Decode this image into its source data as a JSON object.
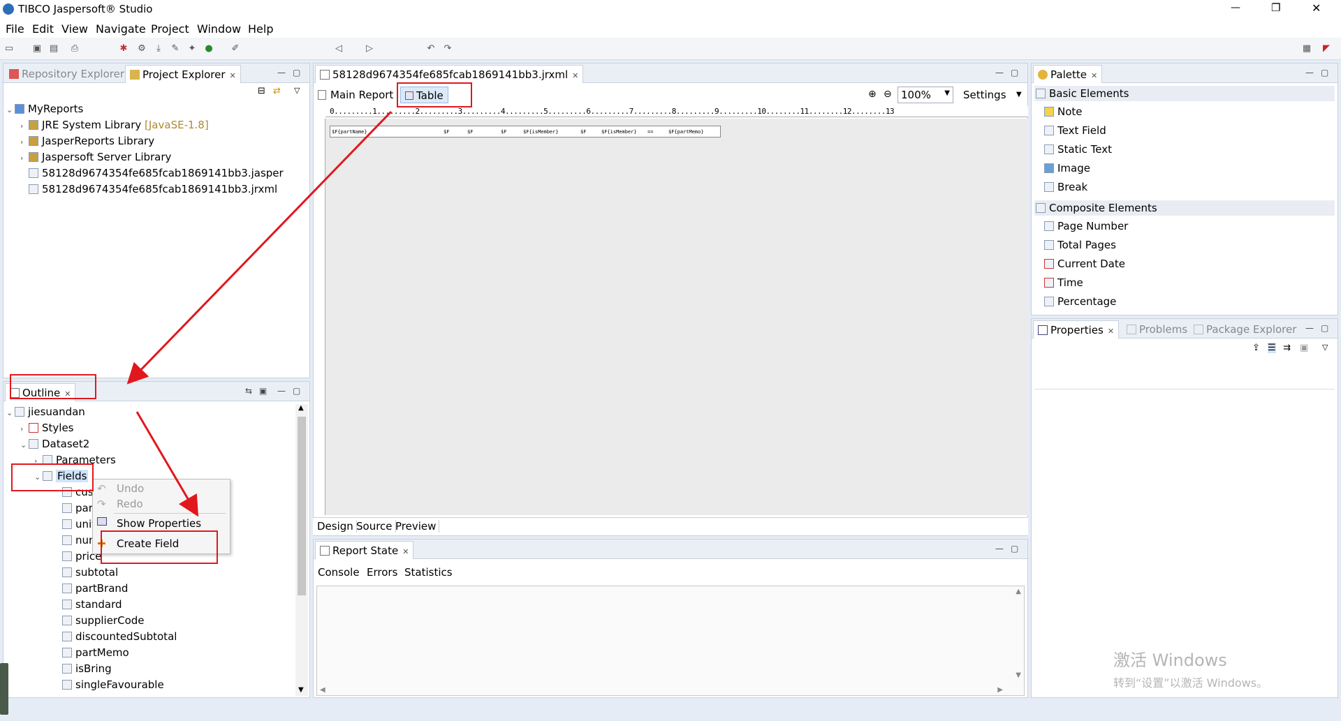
{
  "app": {
    "title": "TIBCO Jaspersoft® Studio",
    "window_controls": {
      "minimize": "—",
      "restore": "❐",
      "close": "✕"
    }
  },
  "menu": [
    "File",
    "Edit",
    "View",
    "Navigate",
    "Project",
    "Window",
    "Help"
  ],
  "left_top": {
    "tabs": [
      "Repository Explorer",
      "Project Explorer"
    ],
    "tree": [
      {
        "label": "MyReports",
        "level": 0,
        "exp": "⌄"
      },
      {
        "label": "JRE System Library",
        "suffix": "[JavaSE-1.8]",
        "level": 1,
        "exp": "›"
      },
      {
        "label": "JasperReports Library",
        "level": 1,
        "exp": "›"
      },
      {
        "label": "Jaspersoft Server Library",
        "level": 1,
        "exp": "›"
      },
      {
        "label": "58128d9674354fe685fcab1869141bb3.jasper",
        "level": 1,
        "exp": ""
      },
      {
        "label": "58128d9674354fe685fcab1869141bb3.jrxml",
        "level": 1,
        "exp": ""
      }
    ]
  },
  "outline": {
    "tab": "Outline",
    "tree": [
      {
        "label": "jiesuandan",
        "level": 0,
        "exp": "⌄"
      },
      {
        "label": "Styles",
        "level": 1,
        "exp": "›"
      },
      {
        "label": "Dataset2",
        "level": 1,
        "exp": "⌄"
      },
      {
        "label": "Parameters",
        "level": 2,
        "exp": "›"
      },
      {
        "label": "Fields",
        "level": 2,
        "exp": "⌄"
      },
      {
        "label": "cus",
        "level": 3,
        "exp": ""
      },
      {
        "label": "par",
        "level": 3,
        "exp": ""
      },
      {
        "label": "unit",
        "level": 3,
        "exp": ""
      },
      {
        "label": "nun",
        "level": 3,
        "exp": ""
      },
      {
        "label": "price",
        "level": 3,
        "exp": ""
      },
      {
        "label": "subtotal",
        "level": 3,
        "exp": ""
      },
      {
        "label": "partBrand",
        "level": 3,
        "exp": ""
      },
      {
        "label": "standard",
        "level": 3,
        "exp": ""
      },
      {
        "label": "supplierCode",
        "level": 3,
        "exp": ""
      },
      {
        "label": "discountedSubtotal",
        "level": 3,
        "exp": ""
      },
      {
        "label": "partMemo",
        "level": 3,
        "exp": ""
      },
      {
        "label": "isBring",
        "level": 3,
        "exp": ""
      },
      {
        "label": "singleFavourable",
        "level": 3,
        "exp": ""
      }
    ]
  },
  "context_menu": {
    "undo": "Undo",
    "redo": "Redo",
    "show_properties": "Show Properties",
    "create_field": "Create Field"
  },
  "editor": {
    "file_tab": "58128d9674354fe685fcab1869141bb3.jrxml",
    "main_report": "Main Report",
    "table": "Table",
    "zoom": "100%",
    "settings": "Settings",
    "ruler": "0.........1.........2.........3.........4.........5.........6.........7.........8.........9.........10........11........12........13",
    "cells": [
      "$F{partName}",
      "$F",
      "$F",
      "$F",
      "$F{isMember}",
      "$F",
      "$F{isMember}",
      "==",
      "$F{partMemo}"
    ],
    "bottom_tabs": [
      "Design",
      "Source",
      "Preview"
    ]
  },
  "report_state": {
    "tab": "Report State",
    "subtabs": [
      "Console",
      "Errors",
      "Statistics"
    ]
  },
  "palette": {
    "tab": "Palette",
    "basic_header": "Basic Elements",
    "basic": [
      "Note",
      "Text Field",
      "Static Text",
      "Image",
      "Break"
    ],
    "composite_header": "Composite Elements",
    "composite": [
      "Page Number",
      "Total Pages",
      "Current Date",
      "Time",
      "Percentage"
    ]
  },
  "properties": {
    "tabs": [
      "Properties",
      "Problems",
      "Package Explorer"
    ]
  },
  "watermark": {
    "line1": "激活 Windows",
    "line2": "转到“设置”以激活 Windows。"
  },
  "colors": {
    "annotation": "#e0181e",
    "accent": "#3a7bd5"
  }
}
